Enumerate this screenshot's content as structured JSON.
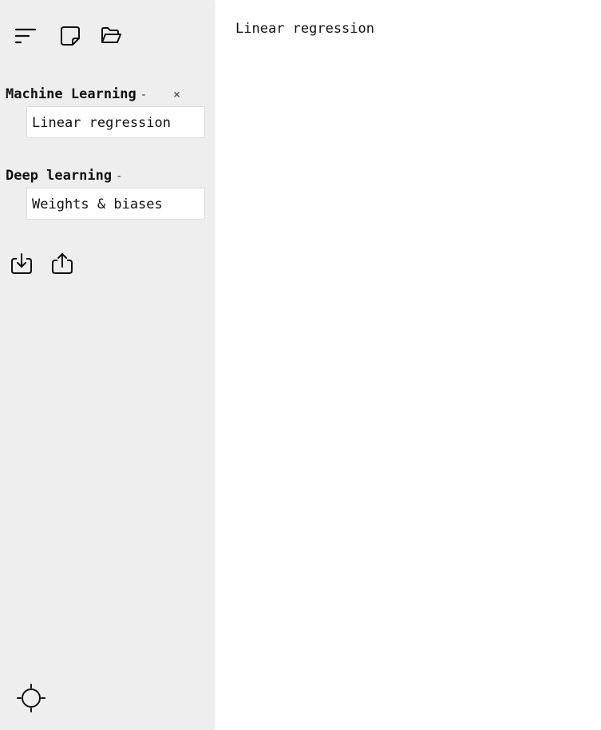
{
  "sidebar": {
    "top_toolbar": {
      "buttons": [
        {
          "icon": "sort-lines-icon"
        },
        {
          "icon": "new-note-icon"
        },
        {
          "icon": "open-folder-icon"
        }
      ]
    },
    "folders": [
      {
        "name": "Machine Learning",
        "collapse_symbol": "-",
        "delete_symbol": "×",
        "notes": [
          "Linear regression"
        ]
      },
      {
        "name": "Deep learning",
        "collapse_symbol": "-",
        "notes": [
          "Weights & biases"
        ]
      }
    ],
    "io_toolbar": {
      "buttons": [
        {
          "icon": "import-icon"
        },
        {
          "icon": "export-icon"
        }
      ]
    },
    "theme_toggle": {
      "icon": "sun-icon"
    }
  },
  "editor": {
    "content": "Linear regression"
  },
  "colors": {
    "sidebar_bg": "#eeeeee",
    "main_bg": "#ffffff",
    "note_bg": "#ffffff",
    "text": "#111111"
  }
}
